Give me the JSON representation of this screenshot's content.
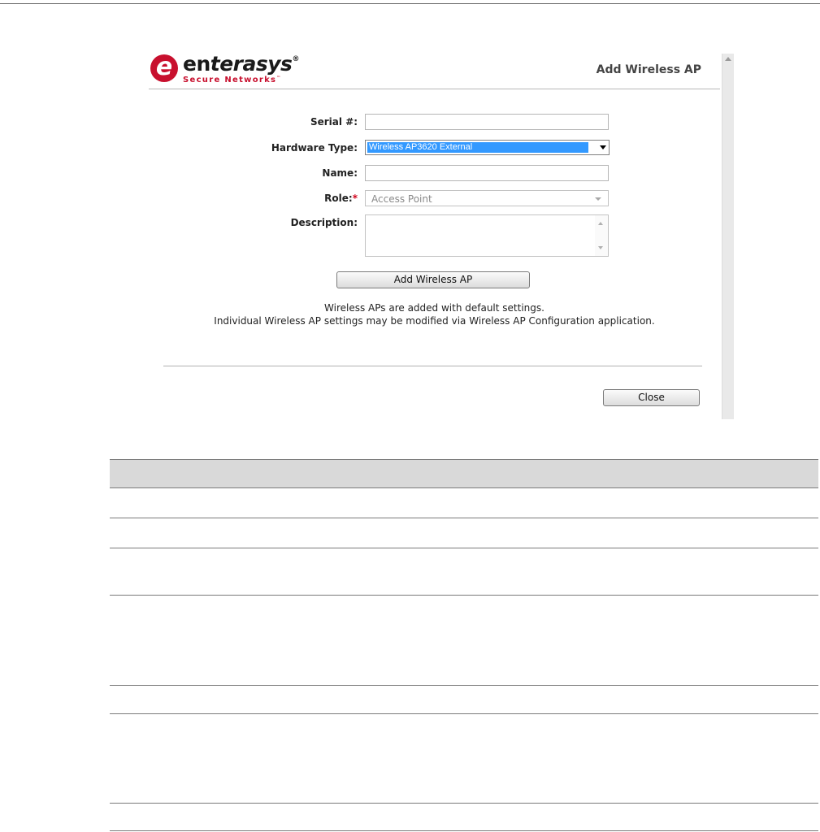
{
  "dialog": {
    "title": "Add Wireless AP",
    "logo": {
      "mark": "e",
      "word_a": "en",
      "word_b": "terasys",
      "registered": "®",
      "tagline": "Secure Networks",
      "trademark": "™"
    },
    "form": {
      "serial_label": "Serial #:",
      "serial_value": "",
      "hardware_label": "Hardware Type:",
      "hardware_value": "Wireless AP3620 External",
      "name_label": "Name:",
      "name_value": "",
      "role_label": "Role:",
      "role_required": "*",
      "role_value": "Access Point",
      "description_label": "Description:",
      "description_value": ""
    },
    "add_button_label": "Add Wireless AP",
    "notes": [
      "Wireless APs are added with default settings.",
      "Individual Wireless AP settings may be modified via Wireless AP Configuration application."
    ],
    "close_button_label": "Close"
  },
  "colors": {
    "brand": "#c8102e",
    "selection": "#3399ff",
    "table_header": "#d9d9d9"
  }
}
